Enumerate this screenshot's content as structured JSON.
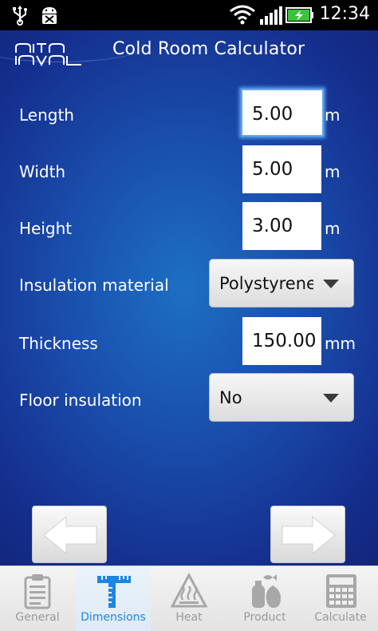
{
  "status_bar": {
    "time": "12:34",
    "icons": [
      "usb-icon",
      "android-debug-icon",
      "wifi-icon",
      "signal-icon",
      "battery-charging-icon"
    ]
  },
  "header": {
    "title": "Cold Room Calculator",
    "logo": "alfa-laval-logo"
  },
  "form": {
    "length": {
      "label": "Length",
      "value": "5.00",
      "unit": "m"
    },
    "width": {
      "label": "Width",
      "value": "5.00",
      "unit": "m"
    },
    "height": {
      "label": "Height",
      "value": "3.00",
      "unit": "m"
    },
    "insulation_material": {
      "label": "Insulation material",
      "selected": "Polystyrene"
    },
    "thickness": {
      "label": "Thickness",
      "value": "150.00",
      "unit": "mm"
    },
    "floor_insulation": {
      "label": "Floor insulation",
      "selected": "No"
    }
  },
  "navigation": {
    "back_icon": "arrow-left-icon",
    "next_icon": "arrow-right-icon"
  },
  "tabs": [
    {
      "label": "General",
      "icon": "clipboard-icon",
      "active": false
    },
    {
      "label": "Dimensions",
      "icon": "ruler-icon",
      "active": true
    },
    {
      "label": "Heat",
      "icon": "heat-warning-icon",
      "active": false
    },
    {
      "label": "Product",
      "icon": "product-icon",
      "active": false
    },
    {
      "label": "Calculate",
      "icon": "calculator-icon",
      "active": false
    }
  ],
  "colors": {
    "accent": "#1e86e0",
    "background": "#1a4fae",
    "focus": "#5da8e8"
  }
}
